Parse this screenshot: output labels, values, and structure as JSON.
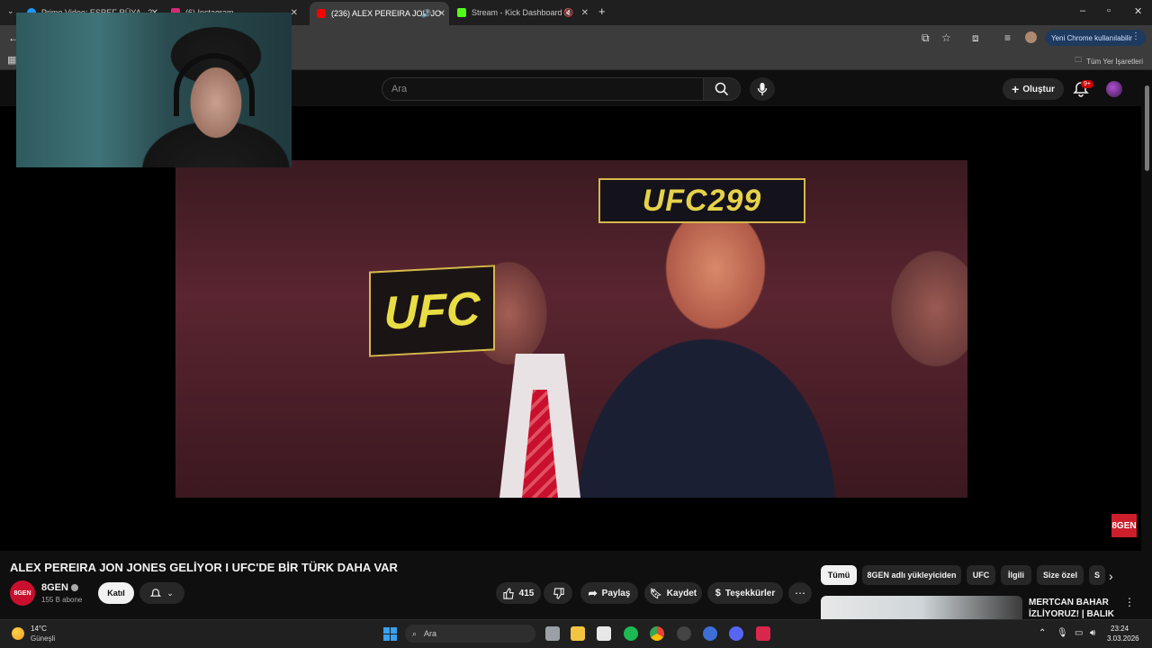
{
  "browser": {
    "tabs": [
      {
        "label": "Prime Video: ESREF RÜYA - 2...",
        "color": "#1a98ff"
      },
      {
        "label": "(6) Instagram",
        "color": "#d62976"
      },
      {
        "label": "(236) ALEX PEREIRA JON JO",
        "color": "#ff0000"
      },
      {
        "label": "Stream - Kick Dashboard",
        "color": "#53fc18"
      }
    ],
    "new_tab_icon": "plus-icon",
    "chrome_notice": "Yeni Chrome kullanılabilir",
    "all_bookmarks": "Tüm Yer İşaretleri"
  },
  "youtube": {
    "search_placeholder": "Ara",
    "create_label": "Oluştur",
    "notification_badge": "9+",
    "video_title": "ALEX PEREIRA JON JONES GELİYOR I UFC'DE BİR TÜRK DAHA VAR",
    "channel": {
      "name": "8GEN",
      "subscribers": "155 B abone",
      "avatar_text": "8GEN"
    },
    "join_label": "Katıl",
    "likes": "415",
    "share_label": "Paylaş",
    "save_label": "Kaydet",
    "thanks_label": "Teşekkürler",
    "chips": [
      "Tümü",
      "8GEN adlı yükleyiciden",
      "UFC",
      "İlgili",
      "Size özel",
      "S"
    ],
    "recommendation_title": "MERTCAN BAHAR İZLİYORUZ! | BALIK ...",
    "watermark": "8GEN",
    "video_overlay": {
      "banner_top": "UFC299",
      "banner_side": "UFC"
    }
  },
  "taskbar": {
    "weather_temp": "14°C",
    "weather_desc": "Güneşli",
    "search_label": "Ara",
    "time": "23:24",
    "date": "3.03.2026"
  }
}
